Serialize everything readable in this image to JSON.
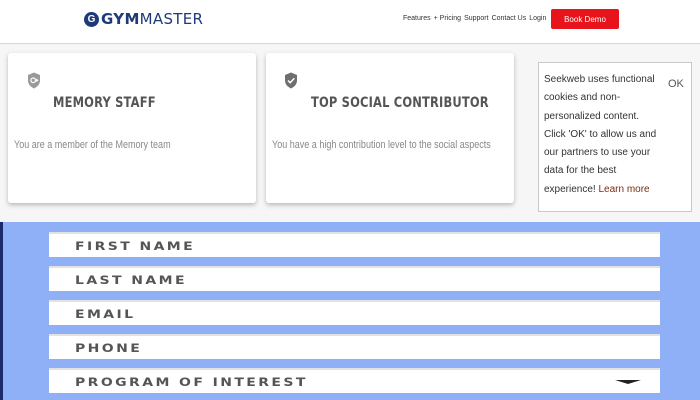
{
  "header": {
    "logo": {
      "mark": "G",
      "gym": "GYM",
      "master": "MASTER"
    },
    "nav": [
      "Features",
      "+ Pricing",
      "Support",
      "Contact Us",
      "Login"
    ],
    "book_demo": "Book Demo"
  },
  "cards": [
    {
      "icon": "badge-plus-icon",
      "title": "MEMORY STAFF",
      "description": "You are a member of the Memory team"
    },
    {
      "icon": "shield-check-icon",
      "title": "TOP SOCIAL CONTRIBUTOR",
      "description": "You have a high contribution level to the social aspects"
    }
  ],
  "cookie": {
    "text": "Seekweb uses functional cookies and non-personalized content. Click 'OK' to allow us and our partners to use your data for the best experience!",
    "link": "Learn more",
    "ok": "OK"
  },
  "form": {
    "fields": [
      {
        "label": "FIRST NAME"
      },
      {
        "label": "LAST NAME"
      },
      {
        "label": "EMAIL"
      },
      {
        "label": "PHONE"
      },
      {
        "label": "PROGRAM OF INTEREST",
        "icon": "caret-down-icon"
      }
    ]
  },
  "colors": {
    "brand": "#1f3a78",
    "button": "#e8141b",
    "form_background": "#8fb0f6",
    "link": "#7a2a12"
  }
}
